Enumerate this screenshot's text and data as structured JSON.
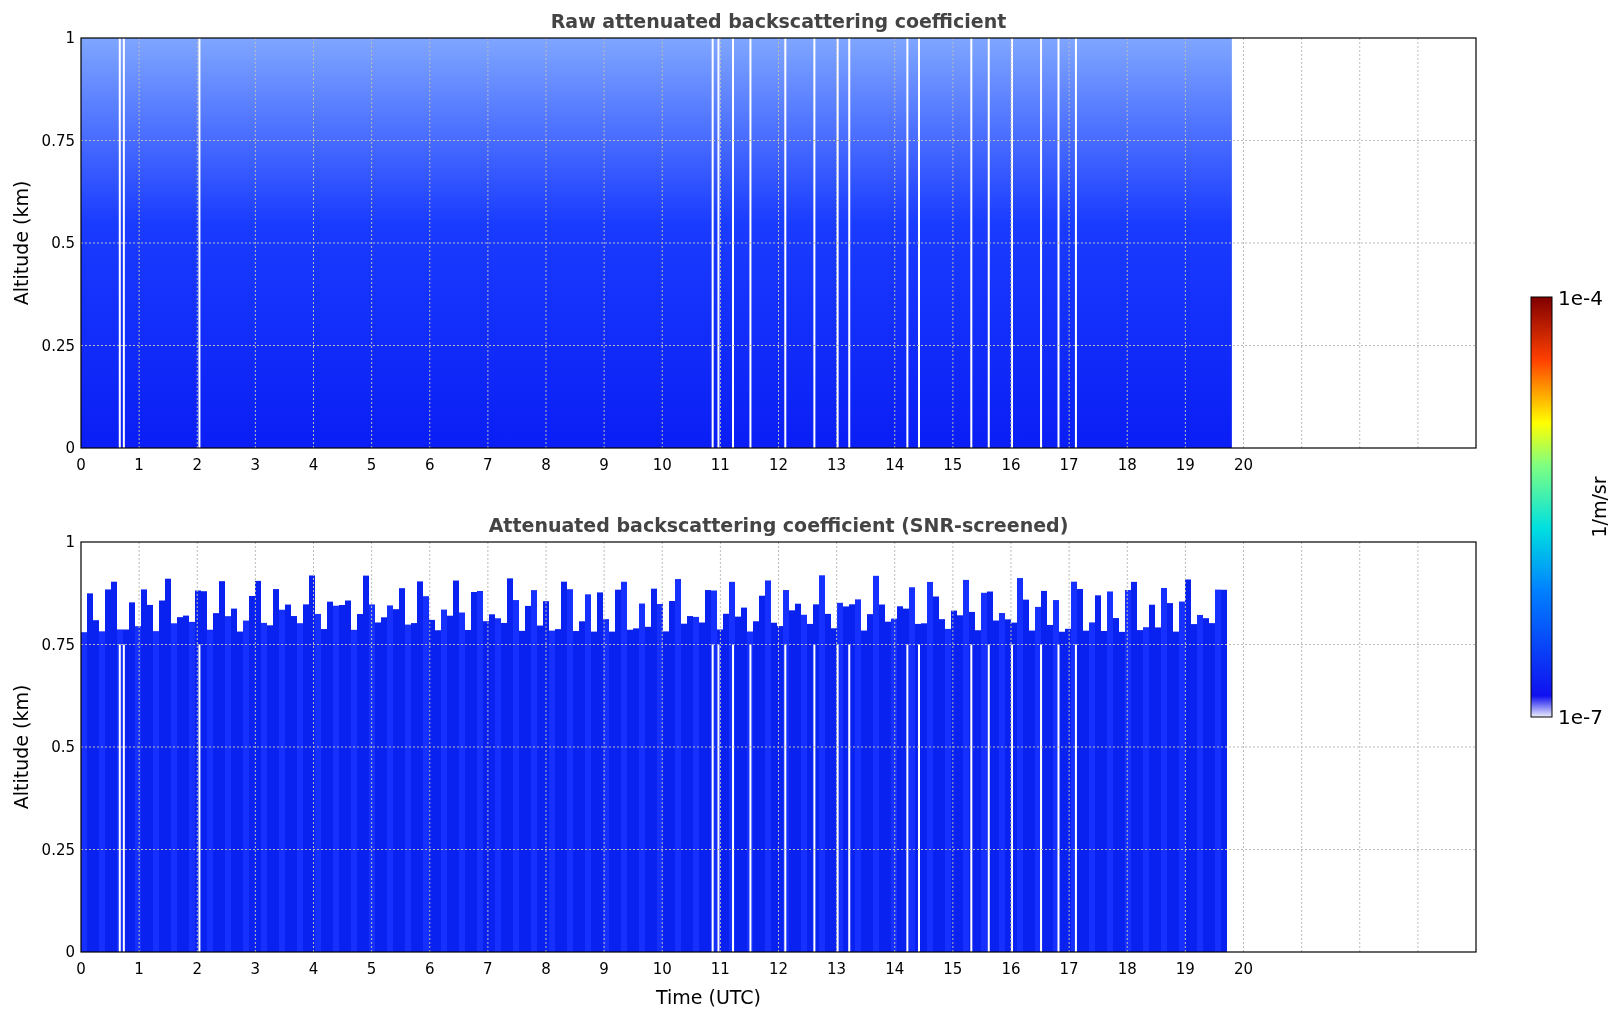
{
  "panels": [
    {
      "title": "Raw attenuated backscattering coefficient",
      "ylabel": "Altitude (km)",
      "yticks": [
        "1",
        "0.75",
        "0.5",
        "0.25",
        "0"
      ],
      "xticks": [
        "0",
        "1",
        "2",
        "3",
        "4",
        "5",
        "6",
        "7",
        "8",
        "9",
        "10",
        "11",
        "12",
        "13",
        "14",
        "15",
        "16",
        "17",
        "18",
        "19",
        "20"
      ],
      "kind": "raw"
    },
    {
      "title": "Attenuated backscattering coefficient (SNR-screened)",
      "ylabel": "Altitude (km)",
      "yticks": [
        "1",
        "0.75",
        "0.5",
        "0.25",
        "0"
      ],
      "xticks": [
        "0",
        "1",
        "2",
        "3",
        "4",
        "5",
        "6",
        "7",
        "8",
        "9",
        "10",
        "11",
        "12",
        "13",
        "14",
        "15",
        "16",
        "17",
        "18",
        "19",
        "20"
      ],
      "kind": "screened",
      "xlabel": "Time (UTC)"
    }
  ],
  "colorbar": {
    "label": "1/m/sr",
    "max": "1e-4",
    "min": "1e-7"
  }
}
